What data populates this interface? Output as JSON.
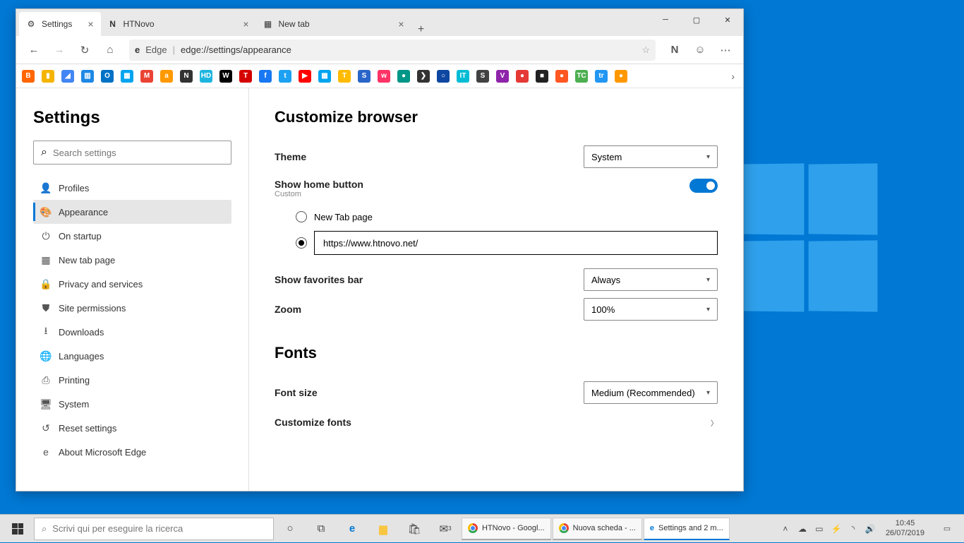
{
  "window": {
    "tabs": [
      {
        "label": "Settings",
        "active": true
      },
      {
        "label": "HTNovo",
        "active": false
      },
      {
        "label": "New tab",
        "active": false
      }
    ]
  },
  "toolbar": {
    "identity_label": "Edge",
    "url": "edge://settings/appearance"
  },
  "sidebar": {
    "title": "Settings",
    "search_placeholder": "Search settings",
    "items": [
      {
        "label": "Profiles",
        "icon": "person"
      },
      {
        "label": "Appearance",
        "icon": "palette",
        "active": true
      },
      {
        "label": "On startup",
        "icon": "power"
      },
      {
        "label": "New tab page",
        "icon": "grid"
      },
      {
        "label": "Privacy and services",
        "icon": "lock"
      },
      {
        "label": "Site permissions",
        "icon": "permissions"
      },
      {
        "label": "Downloads",
        "icon": "download"
      },
      {
        "label": "Languages",
        "icon": "globe"
      },
      {
        "label": "Printing",
        "icon": "print"
      },
      {
        "label": "System",
        "icon": "system"
      },
      {
        "label": "Reset settings",
        "icon": "reset"
      },
      {
        "label": "About Microsoft Edge",
        "icon": "edge"
      }
    ]
  },
  "main": {
    "section1_title": "Customize browser",
    "theme_label": "Theme",
    "theme_value": "System",
    "home_label": "Show home button",
    "home_sub": "Custom",
    "home_toggle": true,
    "radio_newtab": "New Tab page",
    "radio_url_value": "https://www.htnovo.net/",
    "fav_label": "Show favorites bar",
    "fav_value": "Always",
    "zoom_label": "Zoom",
    "zoom_value": "100%",
    "section2_title": "Fonts",
    "fontsize_label": "Font size",
    "fontsize_value": "Medium (Recommended)",
    "customize_fonts": "Customize fonts"
  },
  "bookmarks": [
    {
      "c": "#ff6600",
      "t": "B"
    },
    {
      "c": "#f4b400",
      "t": "▮"
    },
    {
      "c": "#4285f4",
      "t": "◢"
    },
    {
      "c": "#1e88e5",
      "t": "▥"
    },
    {
      "c": "#0072c6",
      "t": "O"
    },
    {
      "c": "#00a4ef",
      "t": "▦"
    },
    {
      "c": "#ea4335",
      "t": "M"
    },
    {
      "c": "#ff9900",
      "t": "a"
    },
    {
      "c": "#333",
      "t": "N"
    },
    {
      "c": "#1db5e0",
      "t": "HD"
    },
    {
      "c": "#000",
      "t": "W"
    },
    {
      "c": "#d50000",
      "t": "T"
    },
    {
      "c": "#1877f2",
      "t": "f"
    },
    {
      "c": "#1da1f2",
      "t": "t"
    },
    {
      "c": "#ff0000",
      "t": "▶"
    },
    {
      "c": "#00a4ef",
      "t": "▦"
    },
    {
      "c": "#ffbb00",
      "t": "T"
    },
    {
      "c": "#2a66c9",
      "t": "S"
    },
    {
      "c": "#ff3366",
      "t": "w"
    },
    {
      "c": "#009688",
      "t": "●"
    },
    {
      "c": "#333",
      "t": "❯"
    },
    {
      "c": "#0d47a1",
      "t": "○"
    },
    {
      "c": "#00bcd4",
      "t": "IT"
    },
    {
      "c": "#424242",
      "t": "S"
    },
    {
      "c": "#8e24aa",
      "t": "V"
    },
    {
      "c": "#e53935",
      "t": "●"
    },
    {
      "c": "#212121",
      "t": "■"
    },
    {
      "c": "#ff5722",
      "t": "●"
    },
    {
      "c": "#4caf50",
      "t": "TC"
    },
    {
      "c": "#2196f3",
      "t": "tr"
    },
    {
      "c": "#ff9800",
      "t": "●"
    }
  ],
  "taskbar": {
    "search_placeholder": "Scrivi qui per eseguire la ricerca",
    "apps": [
      {
        "label": "HTNovo - Googl...",
        "icon": "chrome"
      },
      {
        "label": "Nuova scheda - ...",
        "icon": "chrome"
      },
      {
        "label": "Settings and 2 m...",
        "icon": "edge",
        "active": true
      }
    ],
    "time": "10:45",
    "date": "26/07/2019"
  }
}
